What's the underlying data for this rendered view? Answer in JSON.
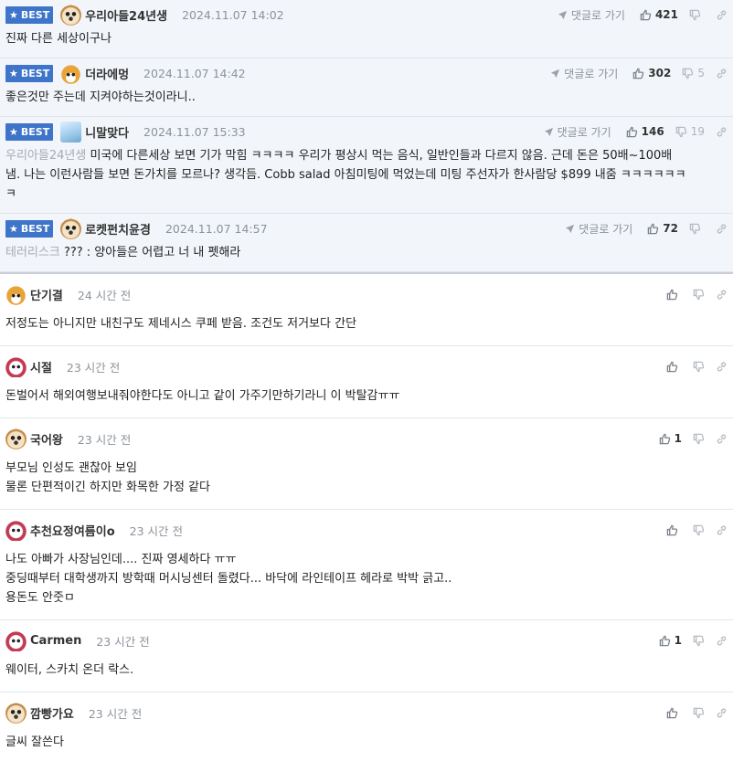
{
  "labels": {
    "best": "BEST",
    "reply_link": "댓글로 가기"
  },
  "best_comments": [
    {
      "nick": "우리아들24년생",
      "time": "2024.11.07 14:02",
      "up": "421",
      "down": "",
      "avatar": "dog-icon",
      "quote": "",
      "lines": [
        "진짜 다른 세상이구나"
      ]
    },
    {
      "nick": "더라에멍",
      "time": "2024.11.07 14:42",
      "up": "302",
      "down": "5",
      "avatar": "fox-icon",
      "quote": "",
      "lines": [
        "좋은것만 주는데 지켜야하는것이라니.."
      ]
    },
    {
      "nick": "니말맞다",
      "time": "2024.11.07 15:33",
      "up": "146",
      "down": "19",
      "avatar": "ice-icon",
      "quote": "우리아들24년생",
      "lines": [
        "미국에 다른세상 보면 기가 막힘 ㅋㅋㅋㅋ 우리가 평상시 먹는 음식, 일반인들과 다르지 않음. 근데 돈은 50배~100배",
        "냄. 나는 이런사람들 보면 돈가치를 모르나? 생각듬. Cobb salad 아침미팅에 먹었는데 미팅 주선자가 한사람당 $899 내줌 ㅋㅋㅋㅋㅋㅋ",
        "ㅋ"
      ]
    },
    {
      "nick": "로켓펀치윤경",
      "time": "2024.11.07 14:57",
      "up": "72",
      "down": "",
      "avatar": "dog-icon",
      "quote": "테러리스크",
      "lines": [
        "??? : 양아들은 어렵고 너 내 펫해라"
      ]
    }
  ],
  "comments": [
    {
      "nick": "단기결",
      "time": "24 시간 전",
      "up": "",
      "avatar": "fox-icon",
      "lines": [
        "저정도는 아니지만 내친구도 제네시스 쿠페 받음. 조건도 저거보다 간단"
      ]
    },
    {
      "nick": "시절",
      "time": "23 시간 전",
      "up": "",
      "avatar": "pink-icon",
      "lines": [
        "돈벌어서 해외여행보내줘야한다도 아니고 같이 가주기만하기라니 이 박탈감ㅠㅠ"
      ]
    },
    {
      "nick": "국어왕",
      "time": "23 시간 전",
      "up": "1",
      "avatar": "dog-icon",
      "lines": [
        "부모님 인성도 괜찮아 보임",
        "물론 단편적이긴 하지만 화목한 가정 같다"
      ]
    },
    {
      "nick": "추천요정여름이o",
      "time": "23 시간 전",
      "up": "",
      "avatar": "pink-icon",
      "lines": [
        "나도 아빠가 사장님인데.... 진짜 영세하다 ㅠㅠ",
        "중딩때부터 대학생까지 방학때 머시닝센터 돌렸다... 바닥에 라인테이프 헤라로 박박 긁고..",
        "용돈도 안줏ㅁ"
      ]
    },
    {
      "nick": "Carmen",
      "time": "23 시간 전",
      "up": "1",
      "avatar": "pink-icon",
      "lines": [
        "웨이터, 스카치 온더 락스."
      ]
    },
    {
      "nick": "깜빵가요",
      "time": "23 시간 전",
      "up": "",
      "avatar": "dog-icon",
      "lines": [
        "글씨 잘쓴다"
      ]
    }
  ]
}
